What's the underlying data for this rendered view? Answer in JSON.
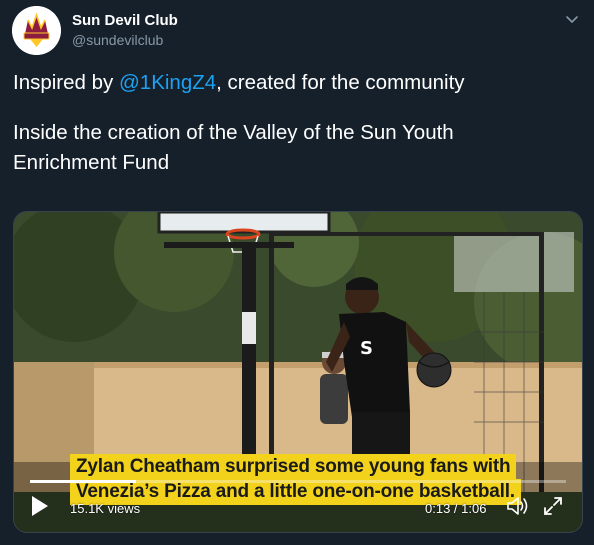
{
  "account": {
    "name": "Sun Devil Club",
    "handle": "@sundevilclub",
    "avatar_icon": "sun-devil-club-logo"
  },
  "tweet": {
    "line1_prefix": "Inspired by ",
    "mention": "@1KingZ4",
    "line1_suffix": ", created for the community",
    "line2": "Inside the creation of the Valley of the Sun Youth",
    "line3": "Enrichment Fund"
  },
  "video": {
    "caption_line1": "Zylan Cheatham surprised some young fans with",
    "caption_line2": "Venezia’s Pizza and a little one-on-one basketball.",
    "views": "15.1K views",
    "time": "0:13 / 1:06",
    "progress": 0.197
  },
  "colors": {
    "background": "#15202b",
    "accent": "#1da1f2",
    "caption_bg": "#f2d21b",
    "muted": "#8899a6"
  }
}
